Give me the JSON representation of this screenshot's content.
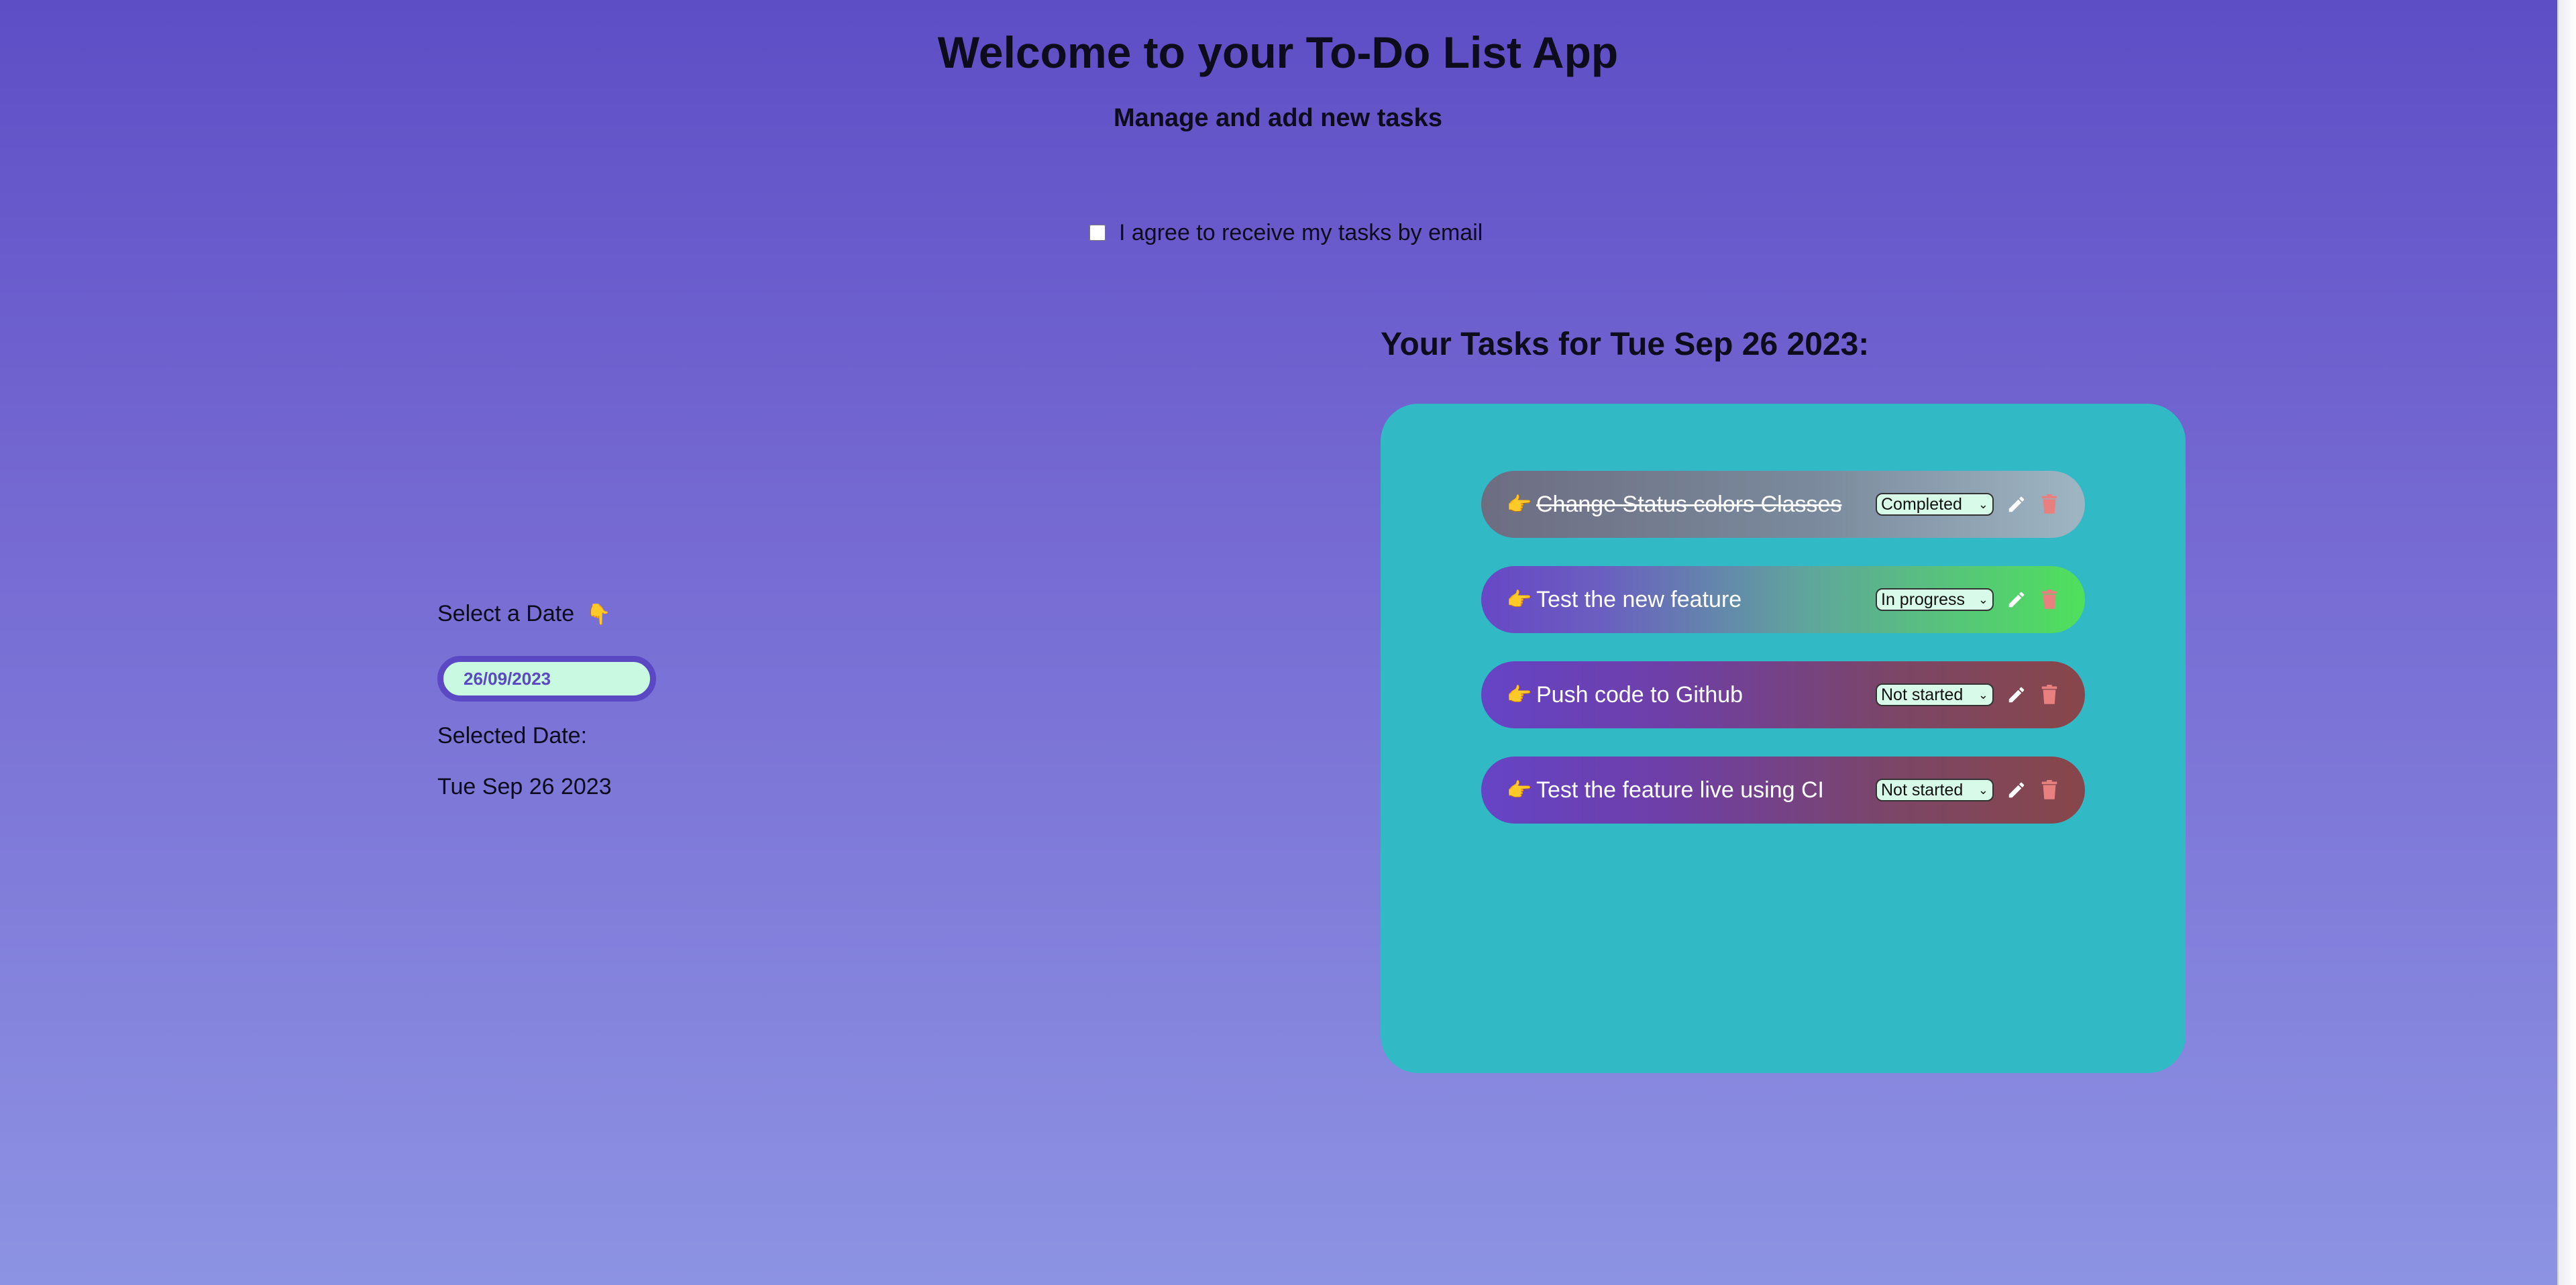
{
  "header": {
    "title": "Welcome to your To-Do List App",
    "subtitle": "Manage and add new tasks"
  },
  "email_consent": {
    "label": "I agree to receive my tasks by email",
    "checked": false
  },
  "date_picker": {
    "label": "Select a Date",
    "label_icon": "finger-down-icon",
    "value": "26/09/2023",
    "selected_label": "Selected Date:",
    "selected_value": "Tue Sep 26 2023"
  },
  "tasks": {
    "heading": "Your Tasks for Tue Sep 26 2023:",
    "items": [
      {
        "name": "Change Status colors Classes",
        "status": "Completed",
        "icon": "hand-pointing-right-icon"
      },
      {
        "name": "Test the new feature",
        "status": "In progress",
        "icon": "hand-pointing-right-icon"
      },
      {
        "name": "Push code to Github",
        "status": "Not started",
        "icon": "hand-pointing-right-icon"
      },
      {
        "name": "Test the feature live using CI",
        "status": "Not started",
        "icon": "hand-pointing-right-icon"
      }
    ]
  },
  "colors": {
    "panel": "#32b9c6",
    "accent": "#5b48c4",
    "delete": "#e88080",
    "completed": "#9fb5c4",
    "in_progress": "#4fe05c",
    "not_started": "#87464a"
  }
}
